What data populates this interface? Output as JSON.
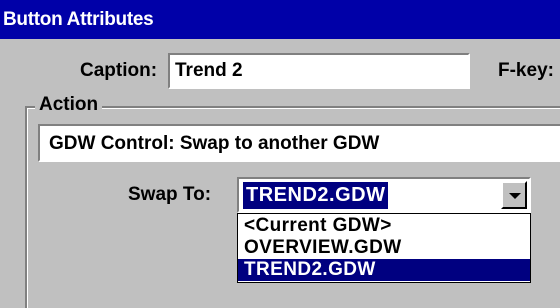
{
  "dialog": {
    "title": "Button Attributes"
  },
  "caption": {
    "label": "Caption:",
    "value": "Trend 2"
  },
  "fkey": {
    "label": "F-key:"
  },
  "action": {
    "group_label": "Action",
    "selected": "GDW Control:  Swap to another GDW"
  },
  "swap": {
    "label": "Swap To:",
    "value": "TREND2.GDW",
    "options": [
      "<Current GDW>",
      "OVERVIEW.GDW",
      "TREND2.GDW"
    ],
    "selected_index": 2
  },
  "colors": {
    "titlebar": "#0000a8",
    "highlight": "#000080",
    "face": "#c0c0c0"
  }
}
